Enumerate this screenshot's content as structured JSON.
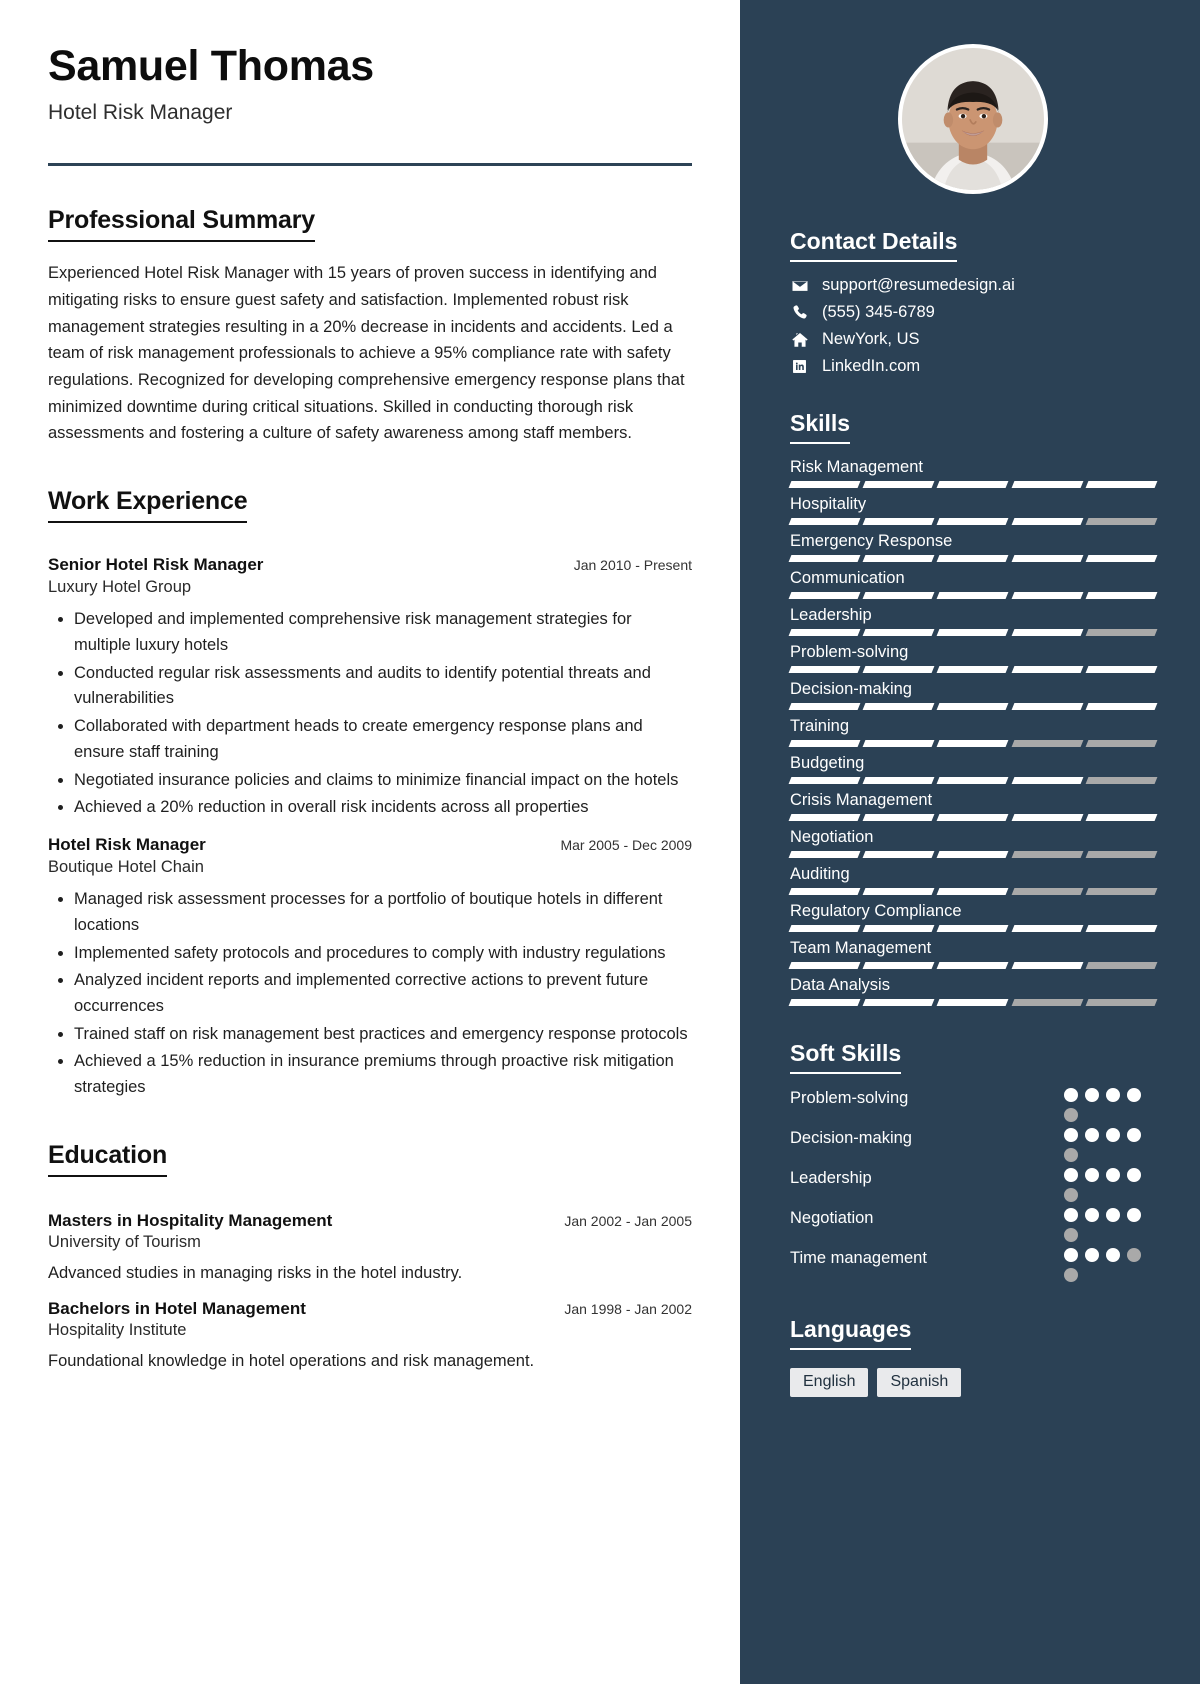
{
  "header": {
    "name": "Samuel Thomas",
    "job_title": "Hotel Risk Manager"
  },
  "summary": {
    "heading": "Professional Summary",
    "text": "Experienced Hotel Risk Manager with 15 years of proven success in identifying and mitigating risks to ensure guest safety and satisfaction. Implemented robust risk management strategies resulting in a 20% decrease in incidents and accidents. Led a team of risk management professionals to achieve a 95% compliance rate with safety regulations. Recognized for developing comprehensive emergency response plans that minimized downtime during critical situations. Skilled in conducting thorough risk assessments and fostering a culture of safety awareness among staff members."
  },
  "work_experience": {
    "heading": "Work Experience",
    "jobs": [
      {
        "role": "Senior Hotel Risk Manager",
        "dates": "Jan 2010 - Present",
        "organization": "Luxury Hotel Group",
        "bullets": [
          "Developed and implemented comprehensive risk management strategies for multiple luxury hotels",
          "Conducted regular risk assessments and audits to identify potential threats and vulnerabilities",
          "Collaborated with department heads to create emergency response plans and ensure staff training",
          "Negotiated insurance policies and claims to minimize financial impact on the hotels",
          "Achieved a 20% reduction in overall risk incidents across all properties"
        ]
      },
      {
        "role": "Hotel Risk Manager",
        "dates": "Mar 2005 - Dec 2009",
        "organization": "Boutique Hotel Chain",
        "bullets": [
          "Managed risk assessment processes for a portfolio of boutique hotels in different locations",
          "Implemented safety protocols and procedures to comply with industry regulations",
          "Analyzed incident reports and implemented corrective actions to prevent future occurrences",
          "Trained staff on risk management best practices and emergency response protocols",
          "Achieved a 15% reduction in insurance premiums through proactive risk mitigation strategies"
        ]
      }
    ]
  },
  "education": {
    "heading": "Education",
    "items": [
      {
        "degree": "Masters in Hospitality Management",
        "dates": "Jan 2002 - Jan 2005",
        "school": "University of Tourism",
        "description": "Advanced studies in managing risks in the hotel industry."
      },
      {
        "degree": "Bachelors in Hotel Management",
        "dates": "Jan 1998 - Jan 2002",
        "school": "Hospitality Institute",
        "description": "Foundational knowledge in hotel operations and risk management."
      }
    ]
  },
  "contact": {
    "heading": "Contact Details",
    "items": [
      {
        "icon": "envelope-icon",
        "value": "support@resumedesign.ai"
      },
      {
        "icon": "phone-icon",
        "value": "(555) 345-6789"
      },
      {
        "icon": "home-icon",
        "value": "NewYork, US"
      },
      {
        "icon": "linkedin-icon",
        "value": "LinkedIn.com"
      }
    ]
  },
  "skills": {
    "heading": "Skills",
    "max_level": 5,
    "items": [
      {
        "label": "Risk Management",
        "level": 5
      },
      {
        "label": "Hospitality",
        "level": 4
      },
      {
        "label": "Emergency Response",
        "level": 5
      },
      {
        "label": "Communication",
        "level": 5
      },
      {
        "label": "Leadership",
        "level": 4
      },
      {
        "label": "Problem-solving",
        "level": 5
      },
      {
        "label": "Decision-making",
        "level": 5
      },
      {
        "label": "Training",
        "level": 3
      },
      {
        "label": "Budgeting",
        "level": 4
      },
      {
        "label": "Crisis Management",
        "level": 5
      },
      {
        "label": "Negotiation",
        "level": 3
      },
      {
        "label": "Auditing",
        "level": 3
      },
      {
        "label": "Regulatory Compliance",
        "level": 5
      },
      {
        "label": "Team Management",
        "level": 4
      },
      {
        "label": "Data Analysis",
        "level": 3
      }
    ]
  },
  "soft_skills": {
    "heading": "Soft Skills",
    "max_level": 5,
    "items": [
      {
        "label": "Problem-solving",
        "level": 4
      },
      {
        "label": "Decision-making",
        "level": 4
      },
      {
        "label": "Leadership",
        "level": 4
      },
      {
        "label": "Negotiation",
        "level": 4
      },
      {
        "label": "Time management",
        "level": 3
      }
    ]
  },
  "languages": {
    "heading": "Languages",
    "items": [
      "English",
      "Spanish"
    ]
  },
  "colors": {
    "sidebar_bg": "#2b4155",
    "accent_rule": "#2d4356",
    "bar_on": "#ffffff",
    "bar_off": "#a9a9a9",
    "lang_chip_bg": "#e9eaec"
  }
}
